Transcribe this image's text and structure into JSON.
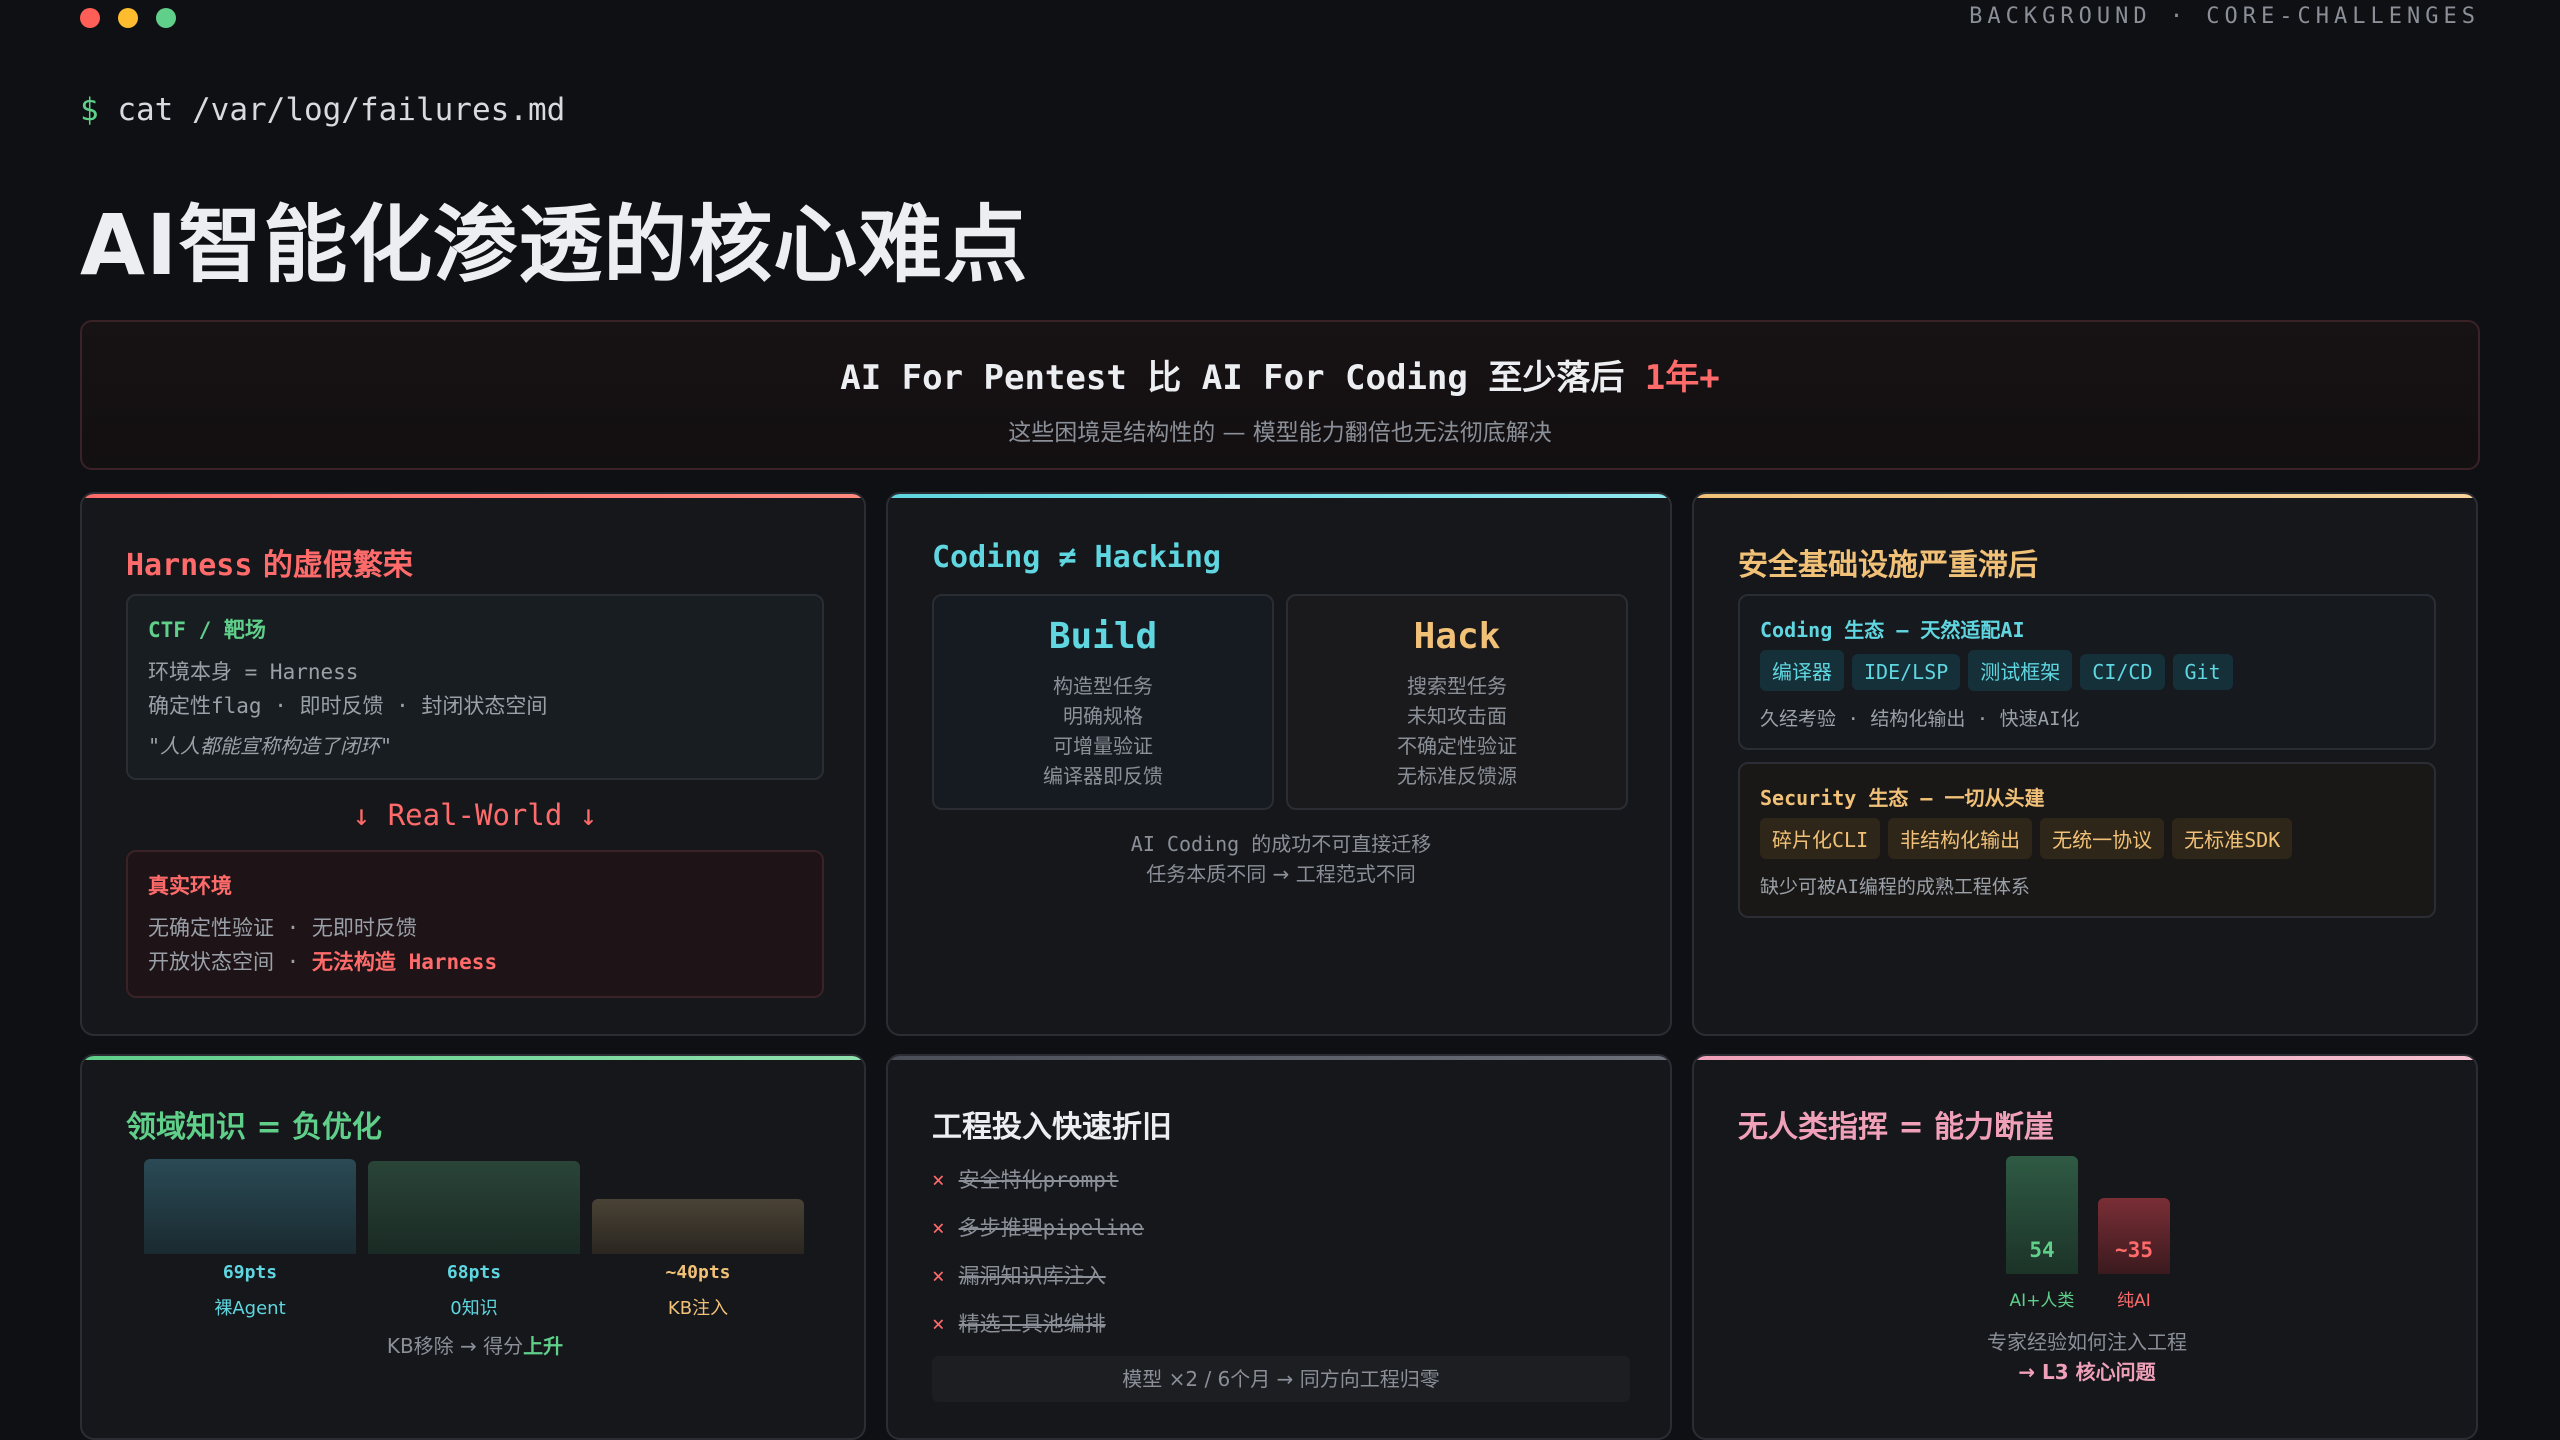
{
  "window": {
    "breadcrumb": "BACKGROUND · CORE-CHALLENGES"
  },
  "terminal": {
    "prompt": "$",
    "command": "cat /var/log/failures.md"
  },
  "page_title": "AI智能化渗透的核心难点",
  "hero": {
    "main_prefix": "AI For Pentest 比 AI For Coding 至少落后 ",
    "main_highlight": "1年+",
    "subtitle": "这些困境是结构性的 — 模型能力翻倍也无法彻底解决"
  },
  "card_harness": {
    "title_en": "Harness",
    "title_zh": " 的虚假繁荣",
    "ctf": {
      "title": "CTF / 靶场",
      "line1": "环境本身 = Harness",
      "line2": "确定性flag · 即时反馈 · 封闭状态空间",
      "quote": "\"人人都能宣称构造了闭环\""
    },
    "arrow_label": "↓ Real-World ↓",
    "real": {
      "title": "真实环境",
      "line1": "无确定性验证 · 无即时反馈",
      "line2_prefix": "开放状态空间 · ",
      "line2_highlight": "无法构造 Harness"
    }
  },
  "card_coding": {
    "title": "Coding ≠ Hacking",
    "build": {
      "title": "Build",
      "items": [
        "构造型任务",
        "明确规格",
        "可增量验证",
        "编译器即反馈"
      ]
    },
    "hack": {
      "title": "Hack",
      "items": [
        "搜索型任务",
        "未知攻击面",
        "不确定性验证",
        "无标准反馈源"
      ]
    },
    "footer1": "AI Coding 的成功不可直接迁移",
    "footer2": "任务本质不同 → 工程范式不同"
  },
  "card_infra": {
    "title": "安全基础设施严重滞后",
    "coding": {
      "title": "Coding 生态 — 天然适配AI",
      "tags": [
        "编译器",
        "IDE/LSP",
        "测试框架",
        "CI/CD",
        "Git"
      ],
      "note": "久经考验 · 结构化输出 · 快速AI化"
    },
    "security": {
      "title": "Security 生态 — 一切从头建",
      "tags": [
        "碎片化CLI",
        "非结构化输出",
        "无统一协议",
        "无标准SDK"
      ],
      "note": "缺少可被AI编程的成熟工程体系"
    }
  },
  "card_knowledge": {
    "title": "领域知识 = 负优化",
    "bars": [
      {
        "score": "69pts",
        "label": "裸Agent",
        "value": 69
      },
      {
        "score": "68pts",
        "label": "0知识",
        "value": 68
      },
      {
        "score": "~40pts",
        "label": "KB注入",
        "value": 40
      }
    ],
    "footer_prefix": "KB移除 → 得分",
    "footer_highlight": "上升"
  },
  "card_engineering": {
    "title": "工程投入快速折旧",
    "items": [
      "安全特化prompt",
      "多步推理pipeline",
      "漏洞知识库注入",
      "精选工具池编排"
    ],
    "x_mark": "×",
    "footer": "模型 ×2 / 6个月 → 同方向工程归零"
  },
  "card_human": {
    "title": "无人类指挥 = 能力断崖",
    "bars": [
      {
        "value_text": "54",
        "label": "AI+人类",
        "value": 54
      },
      {
        "value_text": "~35",
        "label": "纯AI",
        "value": 35
      }
    ],
    "footer1": "专家经验如何注入工程",
    "footer2": "→ L3 核心问题"
  },
  "colors": {
    "red": "#ff6b6b",
    "cyan": "#5fd6e0",
    "gold": "#f2c178",
    "green": "#5fcf8a",
    "pink": "#f0a0b8"
  }
}
